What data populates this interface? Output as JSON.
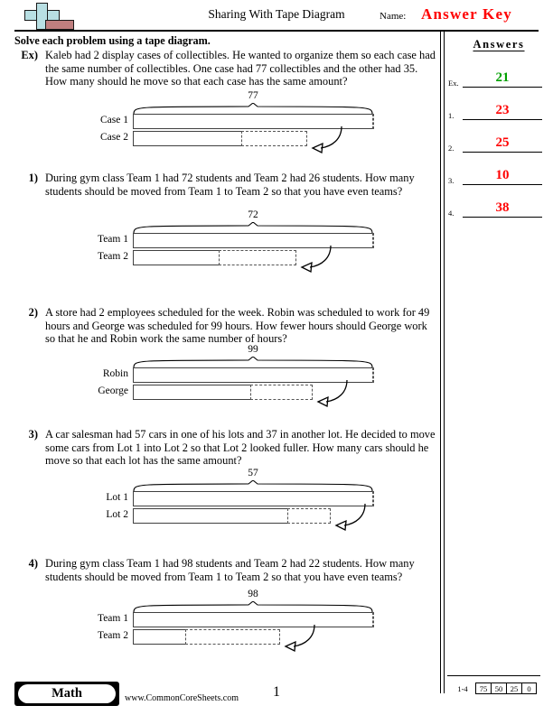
{
  "header": {
    "title": "Sharing With Tape Diagram",
    "name_label": "Name:",
    "answer_key": "Answer Key",
    "logo_icon": "plus-block-logo"
  },
  "instructions": "Solve each problem using a tape diagram.",
  "answers_column": {
    "heading": "Answers",
    "rows": [
      {
        "index": "Ex.",
        "value": "21",
        "color": "#00a000"
      },
      {
        "index": "1.",
        "value": "23",
        "color": "#ff0000"
      },
      {
        "index": "2.",
        "value": "25",
        "color": "#ff0000"
      },
      {
        "index": "3.",
        "value": "10",
        "color": "#ff0000"
      },
      {
        "index": "4.",
        "value": "38",
        "color": "#ff0000"
      }
    ]
  },
  "problems": [
    {
      "number": "Ex)",
      "text": "Kaleb had 2 display cases of collectibles. He wanted to organize them so each case had the same number of collectibles. One case had 77 collectibles and the other had 35. How many should he move so that each case has the same amount?",
      "diagram": {
        "total_label": "77",
        "row1_label": "Case 1",
        "row2_label": "Case 2",
        "row1_solid_value": 77,
        "row2_solid_value": 35,
        "max_value": 77,
        "target_value": 56
      }
    },
    {
      "number": "1)",
      "text": "During gym class Team 1 had 72 students and Team 2 had 26 students. How many students should be moved from Team 1 to Team 2 so that you have even teams?",
      "diagram": {
        "total_label": "72",
        "row1_label": "Team 1",
        "row2_label": "Team 2",
        "row1_solid_value": 72,
        "row2_solid_value": 26,
        "max_value": 72,
        "target_value": 49
      }
    },
    {
      "number": "2)",
      "text": "A store had 2 employees scheduled for the week. Robin was scheduled to work for 49 hours and George was scheduled for 99 hours. How fewer hours should George work so that he and Robin work the same number of hours?",
      "diagram": {
        "total_label": "99",
        "row1_label": "Robin",
        "row2_label": "George",
        "row1_solid_value": 99,
        "row2_solid_value": 49,
        "max_value": 99,
        "target_value": 74
      }
    },
    {
      "number": "3)",
      "text": "A car salesman had 57 cars in one of his lots and 37 in another lot. He decided to move some cars from Lot 1 into Lot 2 so that Lot 2 looked fuller. How many cars should he move so that each lot has the same amount?",
      "diagram": {
        "total_label": "57",
        "row1_label": "Lot 1",
        "row2_label": "Lot 2",
        "row1_solid_value": 57,
        "row2_solid_value": 37,
        "max_value": 57,
        "target_value": 47
      }
    },
    {
      "number": "4)",
      "text": "During gym class Team 1 had 98 students and Team 2 had 22 students. How many students should be moved from Team 1 to Team 2 so that you have even teams?",
      "diagram": {
        "total_label": "98",
        "row1_label": "Team 1",
        "row2_label": "Team 2",
        "row1_solid_value": 98,
        "row2_solid_value": 22,
        "max_value": 98,
        "target_value": 60
      }
    }
  ],
  "footer": {
    "subject_badge": "Math",
    "site_url": "www.CommonCoreSheets.com",
    "page_number": "1",
    "score_range": "1-4",
    "score_cells": [
      "75",
      "50",
      "25",
      "0"
    ]
  }
}
